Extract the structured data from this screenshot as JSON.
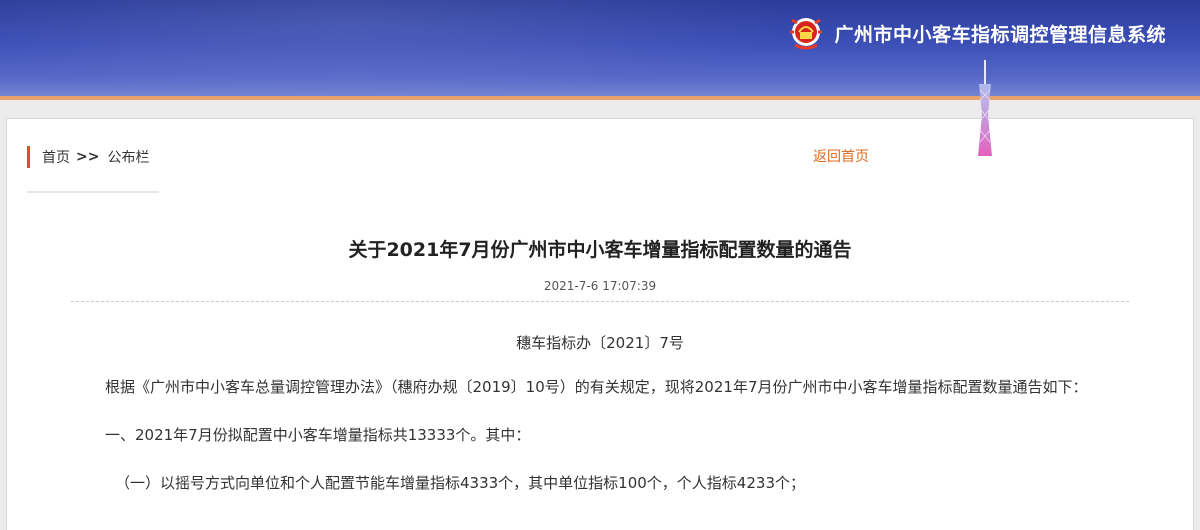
{
  "header": {
    "system_title": "广州市中小客车指标调控管理信息系统",
    "logo_icon": "emblem-icon",
    "tower_icon": "canton-tower-icon"
  },
  "breadcrumb": {
    "home": "首页",
    "separator": ">>",
    "current": "公布栏",
    "back_label": "返回首页"
  },
  "article": {
    "title": "关于2021年7月份广州市中小客车增量指标配置数量的通告",
    "date": "2021-7-6 17:07:39",
    "doc_number": "穗车指标办〔2021〕7号",
    "paragraphs": [
      "根据《广州市中小客车总量调控管理办法》（穗府办规〔2019〕10号）的有关规定，现将2021年7月份广州市中小客车增量指标配置数量通告如下：",
      "一、2021年7月份拟配置中小客车增量指标共13333个。其中：",
      "（一）以摇号方式向单位和个人配置节能车增量指标4333个，其中单位指标100个，个人指标4233个；"
    ]
  },
  "colors": {
    "banner": "#3c4fb6",
    "accent_bar": "#e24b2c",
    "back_link": "#e0691e",
    "banner_stripe": "#e8a36d"
  }
}
